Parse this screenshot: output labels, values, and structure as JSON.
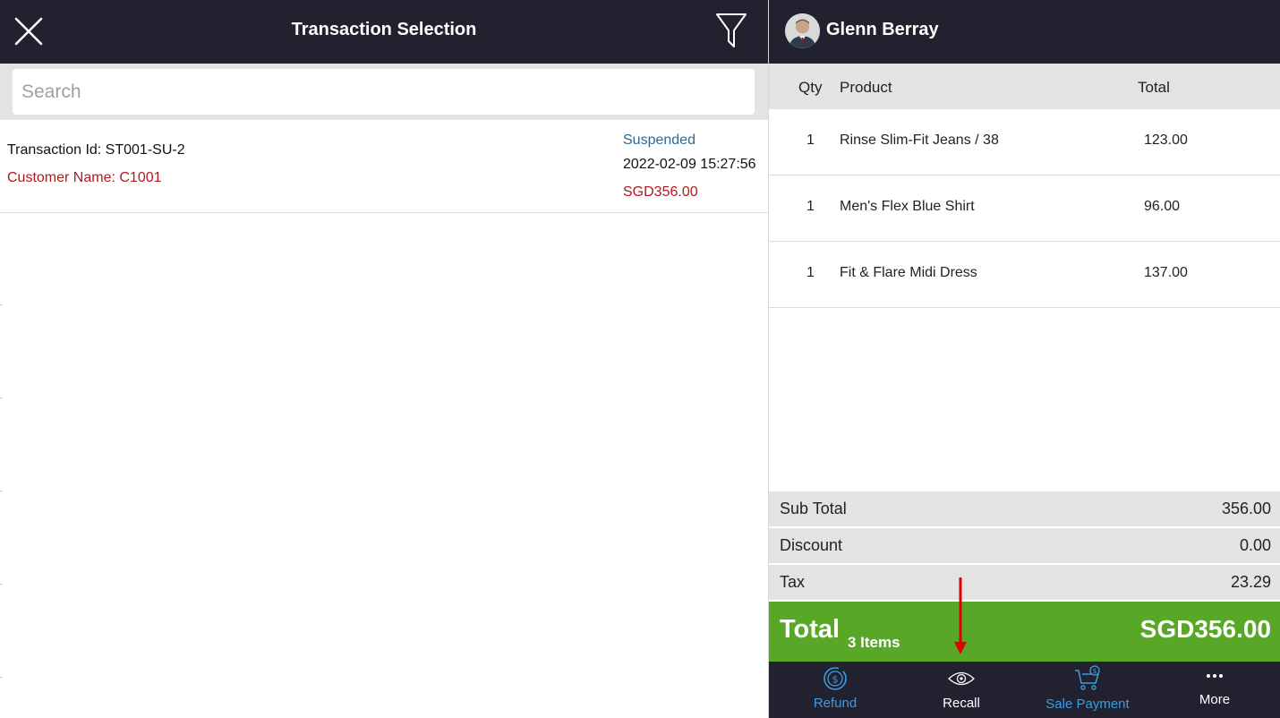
{
  "left_panel": {
    "title": "Transaction Selection",
    "close_icon": "close-icon",
    "filter_icon": "filter-icon",
    "search": {
      "placeholder": "Search",
      "value": ""
    },
    "transactions": [
      {
        "transaction_id": "Transaction Id: ST001-SU-2",
        "customer_name": "Customer Name: C1001",
        "status": "Suspended",
        "datetime": "2022-02-09 15:27:56",
        "amount": "SGD356.00"
      }
    ]
  },
  "right_panel": {
    "customer": {
      "name": "Glenn Berray",
      "avatar_icon": "user-avatar"
    },
    "cart_header": {
      "qty": "Qty",
      "product": "Product",
      "total": "Total"
    },
    "cart_items": [
      {
        "qty": "1",
        "product": "Rinse Slim-Fit Jeans / 38",
        "total": "123.00"
      },
      {
        "qty": "1",
        "product": "Men's Flex Blue Shirt",
        "total": "96.00"
      },
      {
        "qty": "1",
        "product": "Fit & Flare Midi Dress",
        "total": "137.00"
      }
    ],
    "summary": {
      "sub_total_label": "Sub Total",
      "sub_total": "356.00",
      "discount_label": "Discount",
      "discount": "0.00",
      "tax_label": "Tax",
      "tax": "23.29"
    },
    "total_bar": {
      "label": "Total",
      "items": "3 Items",
      "amount": "SGD356.00"
    },
    "bottom_nav": [
      {
        "label": "Refund",
        "icon": "refund-dollar-icon"
      },
      {
        "label": "Recall",
        "icon": "eye-icon"
      },
      {
        "label": "Sale Payment",
        "icon": "cart-dollar-icon"
      },
      {
        "label": "More",
        "icon": "more-dots-icon"
      }
    ]
  },
  "colors": {
    "header_bg": "#22212f",
    "total_green": "#58a727",
    "error_red": "#b0191e",
    "status_blue": "#2b6a8e",
    "nav_active_blue": "#3d9be0",
    "annotation_red": "#e00000"
  }
}
